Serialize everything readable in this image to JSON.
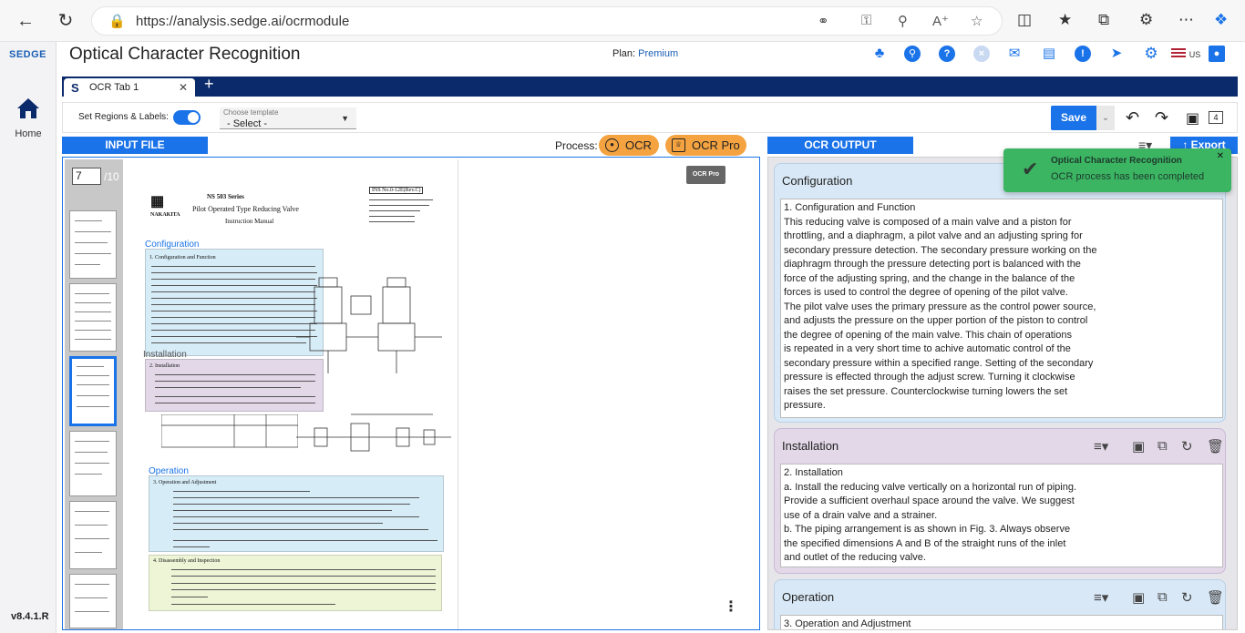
{
  "browser": {
    "url": "https://analysis.sedge.ai/ocrmodule"
  },
  "rail": {
    "logo": "SEDGE",
    "home_label": "Home",
    "version": "v8.4.1.R"
  },
  "header": {
    "title": "Optical Character Recognition",
    "plan_label": "Plan:",
    "plan_value": "Premium",
    "locale": "US"
  },
  "tabs": [
    {
      "label": "OCR Tab 1"
    }
  ],
  "toolbar": {
    "set_regions_label": "Set Regions & Labels:",
    "template_label": "Choose template",
    "template_value": "- Select -",
    "save_label": "Save",
    "page_count": "4"
  },
  "input": {
    "title": "INPUT FILE",
    "process_label": "Process:",
    "ocr_label": "OCR",
    "ocr_pro_label": "OCR Pro",
    "tooltip": "OCR Pro",
    "current_page": "7",
    "total_pages": "/10",
    "doc": {
      "heading1": "NS 503 Series",
      "heading2": "Pilot Operated Type Reducing Valve",
      "heading3": "Instruction Manual",
      "brand": "NAKAKITA",
      "ref": "INS No.0-12E(Rev.C)",
      "region_configuration": "Configuration",
      "region_installation": "Installation",
      "region_operation": "Operation",
      "sec1": "1. Configuration and Function",
      "sec2": "2. Installation",
      "sec3": "3. Operation and Adjustment",
      "sec4": "4. Disassembly and Inspection"
    }
  },
  "output": {
    "title": "OCR OUTPUT",
    "export_label": "Export",
    "cards": [
      {
        "title": "Configuration",
        "lines": [
          "1. Configuration and Function",
          "This reducing valve is composed of a main valve and a piston for",
          "throttling, and a diaphragm, a pilot valve and an adjusting spring for",
          "secondary pressure detection. The secondary pressure working on the",
          "diaphragm through the pressure detecting port is balanced with the",
          "force of the adjusting spring, and the change in the balance of the",
          "forces is used to control the degree of opening of the pilot valve.",
          "The pilot valve uses the primary pressure as the control power source,",
          "and adjusts the pressure on the upper portion of the piston to control",
          "the degree of opening of the main valve. This chain of operations",
          "is repeated in a very short time to achive automatic control of the",
          "secondary pressure within a specified range. Setting of the secondary",
          "pressure is effected through the adjust screw. Turning it clockwise",
          "raises the set pressure. Counterclockwise turning lowers the set",
          "pressure."
        ]
      },
      {
        "title": "Installation",
        "lines": [
          "2. Installation",
          "a. Install the reducing valve vertically on a horizontal run of piping.",
          "Provide a sufficient overhaul space around the valve. We suggest",
          "use of a drain valve and a strainer.",
          "b. The piping arrangement is as shown in Fig. 3. Always observe",
          "the specified dimensions A and B of the straight runs of the inlet",
          "and outlet of the reducing valve."
        ]
      },
      {
        "title": "Operation",
        "lines": [
          "3. Operation and Adjustment"
        ]
      }
    ]
  },
  "toast": {
    "title": "Optical Character Recognition",
    "message": "OCR process has been completed"
  },
  "colors": {
    "accent": "#1a73e8",
    "navy": "#0b2a6b",
    "process_button": "#f4a340",
    "toast": "#3cb563",
    "region_configuration": "#d6ecf7",
    "region_installation": "#e2d8e8",
    "region_operation": "#d6ecf7",
    "region_disassembly": "#eef5d6"
  }
}
